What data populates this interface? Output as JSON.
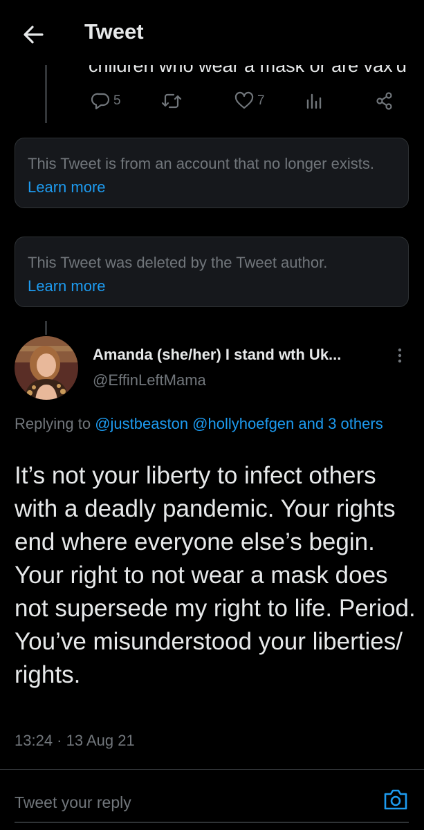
{
  "header": {
    "title": "Tweet"
  },
  "previous_tweet": {
    "cut_text": "children who wear a mask or are vax'd",
    "actions": {
      "reply_count": "5",
      "retweet_count": "",
      "like_count": "7"
    }
  },
  "notices": [
    {
      "text": "This Tweet is from an account that no longer exists.",
      "link": "Learn more"
    },
    {
      "text": "This Tweet was deleted by the Tweet author.",
      "link": "Learn more"
    }
  ],
  "author": {
    "name": "Amanda (she/her) I stand wth Uk...",
    "handle": "@EffinLeftMama"
  },
  "replying": {
    "prefix": "Replying to",
    "mentions": "@justbeaston @hollyhoefgen and 3 others"
  },
  "tweet": {
    "text": "It’s not your liberty to infect others with a deadly pandemic. Your rights end where everyone else’s begin. Your right to not wear a mask does not supersede my right to life. Period.  You’ve misunderstood your liberties/ rights.",
    "timestamp": "13:24 · 13 Aug 21"
  },
  "reply_box": {
    "placeholder": "Tweet your reply"
  },
  "colors": {
    "background": "#000000",
    "text": "#e7e9ea",
    "secondary": "#71767b",
    "accent": "#1d9bf0",
    "card": "#16181c",
    "border": "#2f3336"
  },
  "icons": {
    "back": "arrow-left-icon",
    "reply": "reply-bubble-icon",
    "retweet": "retweet-icon",
    "like": "heart-icon",
    "analytics": "analytics-icon",
    "share": "share-icon",
    "more": "more-vertical-icon",
    "camera": "camera-icon"
  }
}
